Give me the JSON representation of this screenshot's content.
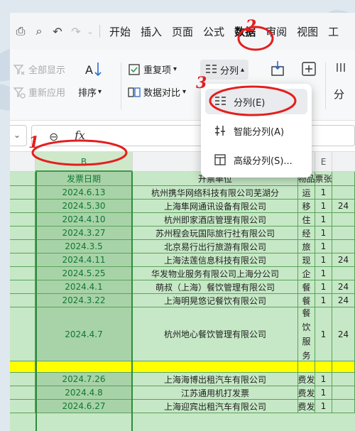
{
  "quick_access": {
    "icons": [
      "print-icon",
      "print-preview-icon",
      "undo-icon",
      "redo-icon"
    ]
  },
  "menu": {
    "items": [
      "开始",
      "插入",
      "页面",
      "公式",
      "数据",
      "审阅",
      "视图",
      "工"
    ],
    "active": "数据"
  },
  "ribbon": {
    "show_all": "全部显示",
    "reapply": "重新应用",
    "sort": "排序",
    "duplicates": "重复项",
    "data_compare": "数据对比",
    "split_columns": "分列",
    "right_partial": "分"
  },
  "dropdown": {
    "items": [
      "分列(E)",
      "智能分列(A)",
      "高级分列(S)..."
    ]
  },
  "formula_bar": {
    "fx_label": "fx"
  },
  "columns": [
    "B",
    "",
    "E"
  ],
  "grid": {
    "header": [
      "发票日期",
      "开票单位",
      "物品",
      "票张",
      ""
    ],
    "rows": [
      [
        "2024.6.13",
        "杭州携华网络科技有限公司芜湖分",
        "运",
        "1",
        ""
      ],
      [
        "2024.5.30",
        "上海隼网通讯设备有限公司",
        "移",
        "1",
        "24"
      ],
      [
        "2024.4.10",
        "杭州即家酒店管理有限公司",
        "住",
        "1",
        ""
      ],
      [
        "2024.3.27",
        "苏州程会玩国际旅行社有限公司",
        "经",
        "1",
        ""
      ],
      [
        "2024.3.5",
        "北京易行出行旅游有限公司",
        "旅",
        "1",
        ""
      ],
      [
        "2024.4.11",
        "上海法莲信息科技有限公司",
        "现",
        "1",
        "24"
      ],
      [
        "2024.5.25",
        "华发物业服务有限公司上海分公司",
        "企",
        "1",
        ""
      ],
      [
        "2024.4.1",
        "萌叔（上海）餐饮管理有限公司",
        "餐",
        "1",
        "24"
      ],
      [
        "2024.3.22",
        "上海明晃悠记餐饮有限公司",
        "餐",
        "1",
        "24"
      ],
      [
        "2024.4.7",
        "杭州地心餐饮管理有限公司",
        "餐饮服务",
        "1",
        "24"
      ],
      [
        "",
        "",
        "",
        "",
        ""
      ],
      [
        "2024.7.26",
        "上海海博出租汽车有限公司",
        "费发",
        "1",
        ""
      ],
      [
        "2024.4.8",
        "江苏通用机打发票",
        "费发",
        "1",
        ""
      ],
      [
        "2024.6.27",
        "上海迎宾出租汽车有限公司",
        "费发",
        "1",
        ""
      ]
    ]
  },
  "annotations": [
    "1",
    "2",
    "3"
  ],
  "colors": {
    "accent_green": "#2e8b3d",
    "cell_green": "#c6e8c6",
    "highlight_yellow": "#ffff00",
    "annotation_red": "#e41e1e"
  }
}
